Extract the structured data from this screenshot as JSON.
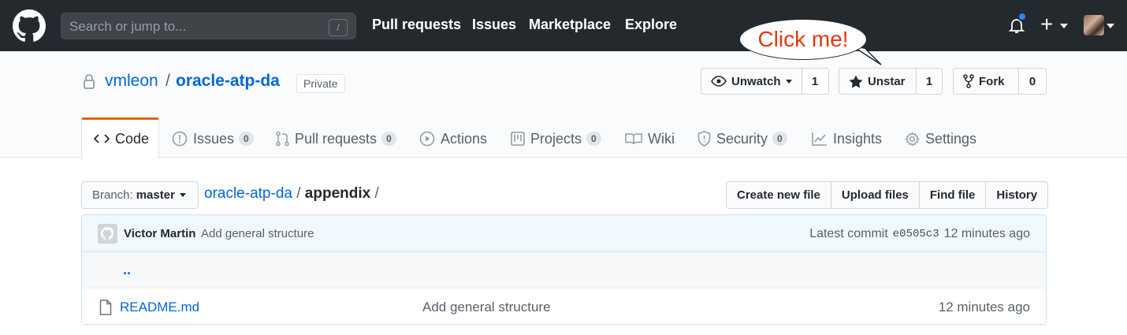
{
  "header": {
    "search_placeholder": "Search or jump to...",
    "search_hotkey": "/",
    "nav": [
      "Pull requests",
      "Issues",
      "Marketplace",
      "Explore"
    ],
    "plus_label": "+"
  },
  "repo": {
    "owner": "vmleon",
    "separator": "/",
    "name": "oracle-atp-da",
    "visibility": "Private",
    "watch": {
      "label": "Unwatch",
      "count": "1"
    },
    "star": {
      "label": "Unstar",
      "count": "1"
    },
    "fork": {
      "label": "Fork",
      "count": "0"
    }
  },
  "callout": {
    "text": "Click me!"
  },
  "tabs": [
    {
      "label": "Code",
      "badge": null
    },
    {
      "label": "Issues",
      "badge": "0"
    },
    {
      "label": "Pull requests",
      "badge": "0"
    },
    {
      "label": "Actions",
      "badge": null
    },
    {
      "label": "Projects",
      "badge": "0"
    },
    {
      "label": "Wiki",
      "badge": null
    },
    {
      "label": "Security",
      "badge": "0"
    },
    {
      "label": "Insights",
      "badge": null
    },
    {
      "label": "Settings",
      "badge": null
    }
  ],
  "branch": {
    "prefix": "Branch:",
    "name": "master"
  },
  "breadcrumb": {
    "repo": "oracle-atp-da",
    "sep1": "/",
    "folder": "appendix",
    "sep2": "/"
  },
  "file_actions": [
    "Create new file",
    "Upload files",
    "Find file",
    "History"
  ],
  "commit": {
    "author": "Victor Martin",
    "message": "Add general structure",
    "latest_label": "Latest commit",
    "sha": "e0505c3",
    "age": "12 minutes ago"
  },
  "files": {
    "up": "..",
    "rows": [
      {
        "name": "README.md",
        "message": "Add general structure",
        "age": "12 minutes ago"
      }
    ]
  },
  "colors": {
    "header_bg": "#24292e",
    "link": "#0366d6",
    "tab_accent": "#e36209",
    "callout_text": "#e8380d"
  }
}
